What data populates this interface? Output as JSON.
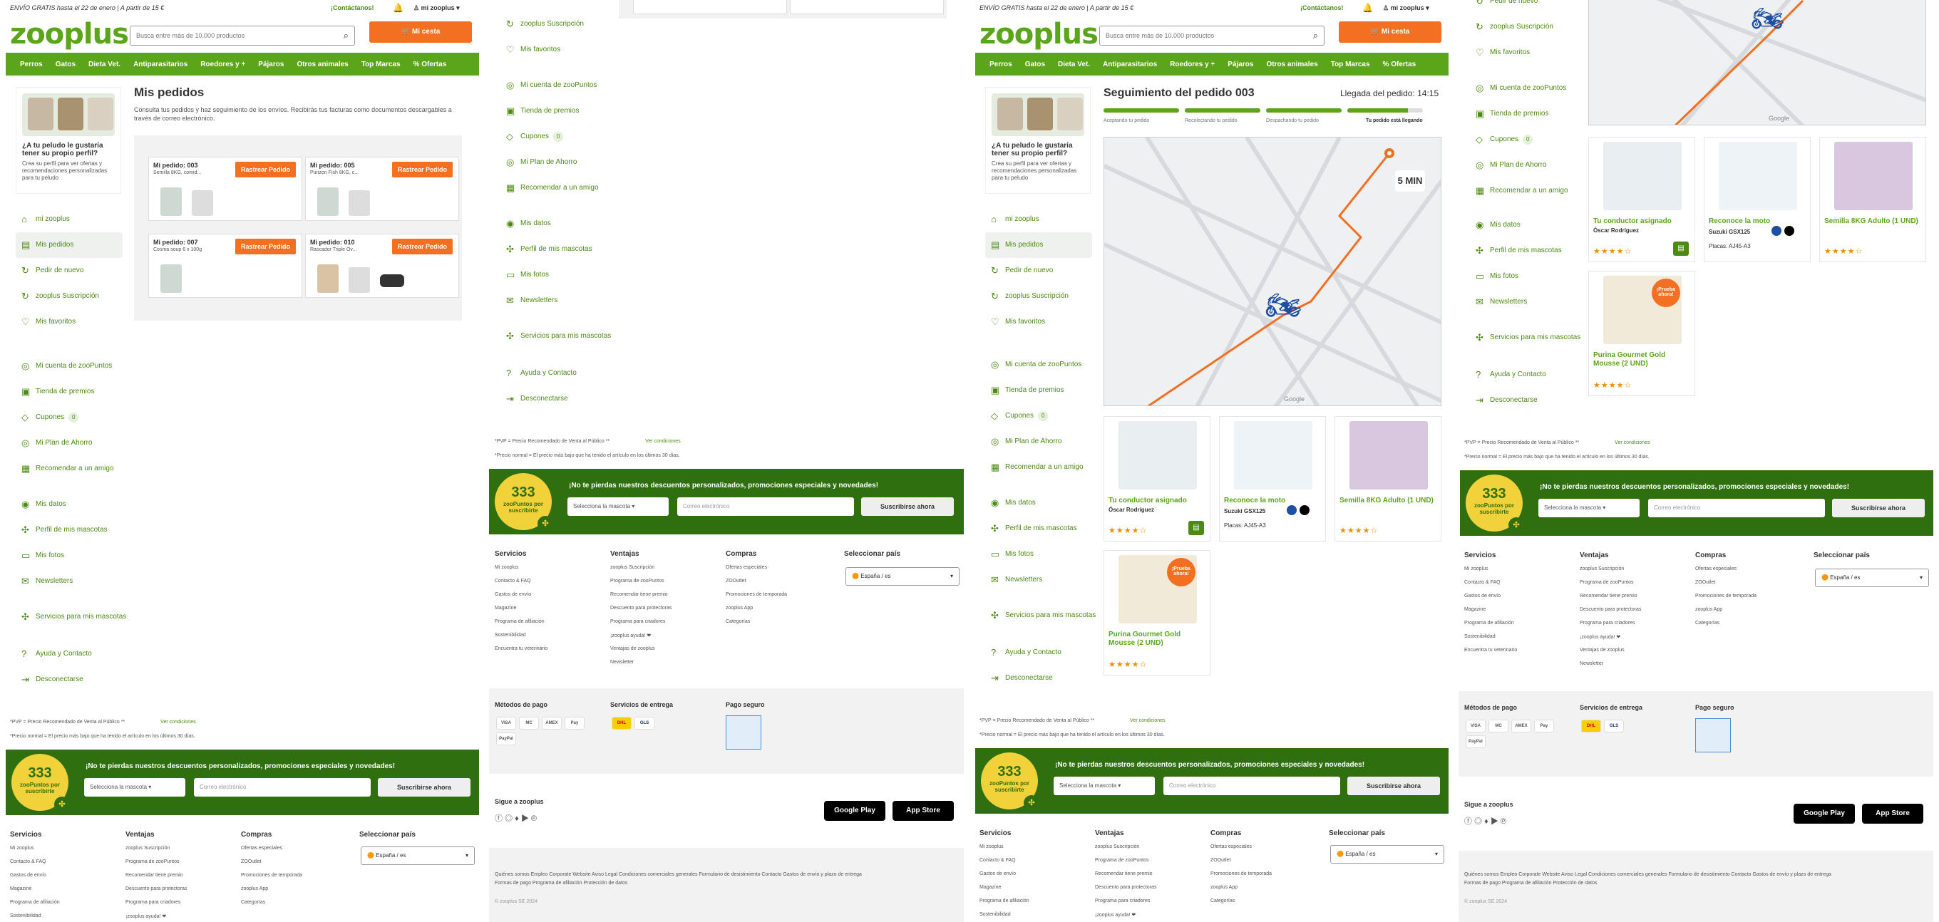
{
  "top": {
    "free_shipping": "ENVÍO GRATIS hasta el 22 de enero | A partir de 15 €",
    "contact": "¡Contáctanos!",
    "account": "mi zooplus"
  },
  "logo": "zooplus",
  "search_placeholder": "Busca entre más de 10.000 productos",
  "basket": "Mi cesta",
  "nav": [
    "Perros",
    "Gatos",
    "Dieta Vet.",
    "Antiparasitarios",
    "Roedores y +",
    "Pájaros",
    "Otros animales",
    "Top Marcas",
    "% Ofertas"
  ],
  "promo": {
    "title": "¿A tu peludo le gustaría tener su propio perfil?",
    "text": "Crea su perfil para ver ofertas y recomendaciones personalizadas para tu peludo"
  },
  "menu_a": [
    {
      "icon": "⌂",
      "label": "mi zooplus"
    },
    {
      "icon": "▤",
      "label": "Mis pedidos",
      "active": true
    },
    {
      "icon": "↻",
      "label": "Pedir de nuevo"
    },
    {
      "icon": "↻",
      "label": "zooplus Suscripción"
    },
    {
      "icon": "♡",
      "label": "Mis favoritos"
    }
  ],
  "menu_b": [
    {
      "icon": "◎",
      "label": "Mi cuenta de zooPuntos"
    },
    {
      "icon": "▣",
      "label": "Tienda de premios"
    },
    {
      "icon": "◇",
      "label": "Cupones",
      "count": "0"
    },
    {
      "icon": "◎",
      "label": "Mi Plan de Ahorro"
    },
    {
      "icon": "▦",
      "label": "Recomendar a un amigo"
    }
  ],
  "menu_c": [
    {
      "icon": "◉",
      "label": "Mis datos"
    },
    {
      "icon": "✣",
      "label": "Perfil de mis mascotas"
    },
    {
      "icon": "▭",
      "label": "Mis fotos"
    },
    {
      "icon": "✉",
      "label": "Newsletters"
    }
  ],
  "menu_d": [
    {
      "icon": "✣",
      "label": "Servicios para mis mascotas"
    },
    {
      "icon": "?",
      "label": "Ayuda y Contacto"
    },
    {
      "icon": "⇥",
      "label": "Desconectarse"
    }
  ],
  "orders_page": {
    "title": "Mis pedidos",
    "intro": "Consulta tus pedidos y haz seguimiento de los envíos. Recibirás tus facturas como documentos descargables a través de correo electrónico.",
    "orders": [
      {
        "n": "Mi pedido: 003",
        "d": "Semilla 8KG, comid...",
        "b": "Rastrear Pedido"
      },
      {
        "n": "Mi pedido: 005",
        "d": "Purizon Fish 8KG, c...",
        "b": "Rastrear Pedido"
      },
      {
        "n": "Mi pedido: 007",
        "d": "Cosma soup 6 x 100g",
        "b": "Rastrear Pedido"
      },
      {
        "n": "Mi pedido: 010",
        "d": "Rascador Triple Ov...",
        "b": "Rastrear Pedido"
      }
    ]
  },
  "tracking": {
    "title": "Seguimiento del pedido 003",
    "arrival": "Llegada del pedido: 14:15",
    "steps": [
      "Aceptando tu pedido",
      "Recolectando tu pedido",
      "Despachando tu pedido",
      "Tu pedido está llegando"
    ],
    "eta": "5 MIN",
    "map_credit": "Google",
    "driver": {
      "title": "Tu conductor asignado",
      "name": "Óscar Rodríguez"
    },
    "moto": {
      "title": "Reconoce la moto",
      "model": "Suzuki GSX125",
      "plate": "Placas: AJ45-A3"
    },
    "p1": {
      "title": "Semilla 8KG Adulto (1 UND)"
    },
    "p2": {
      "title": "Purina Gourmet Gold Mousse (2 UND)",
      "badge": "¡Prueba ahora!"
    },
    "stars": "★★★★☆"
  },
  "notes": {
    "pvpr": "*PVP = Precio Recomendado de Venta al Público **",
    "cond": "Ver condiciones",
    "prev": "*Precio normal = El precio más bajo que ha tenido el artículo en los últimos 30 días."
  },
  "newsletter": {
    "points": "333",
    "points_label": "zooPuntos por suscribirte",
    "text": "¡No te pierdas nuestros descuentos personalizados, promociones especiales y novedades!",
    "select": "Selecciona la mascota",
    "email": "Correo electrónico",
    "button": "Suscribirse ahora"
  },
  "footer": {
    "servicios": {
      "h": "Servicios",
      "items": [
        "Mi zooplus",
        "Contacto & FAQ",
        "Gastos de envío",
        "Magazine",
        "Programa de afiliación",
        "Sostenibilidad",
        "Encuentra tu veterinario"
      ]
    },
    "ventajas": {
      "h": "Ventajas",
      "items": [
        "zooplus Suscripción",
        "Programa de zooPuntos",
        "Recomendar tiene premio",
        "Descuento para protectoras",
        "Programa para criadores",
        "¡zooplus ayuda! ❤",
        "Ventajas de zooplus",
        "Newsletter"
      ]
    },
    "compras": {
      "h": "Compras",
      "items": [
        "Ofertas especiales",
        "ZOOutlet",
        "Promociones de temporada",
        "zooplus App",
        "Categorías"
      ]
    },
    "pais": {
      "h": "Seleccionar país",
      "value": "España / es"
    },
    "pagos": "Métodos de pago",
    "entrega": "Servicios de entrega",
    "seguro": "Pago seguro",
    "sigue": "Sigue a zooplus",
    "google": "Google Play",
    "apple": "App Store",
    "pay_icons": [
      "VISA",
      "MC",
      "AMEX",
      "Pay",
      "PayPal"
    ],
    "ship_icons": [
      "DHL",
      "GLS"
    ],
    "legal": "Quiénes somos   Empleo   Corporate Website   Aviso Legal   Condiciones comerciales generales   Formulario de desistimiento   Contacto   Gastos de envío y plazo de entrega",
    "legal2": "Formas de pago   Programa de afiliación   Protección de datos",
    "copy": "© zooplus SE 2024"
  }
}
